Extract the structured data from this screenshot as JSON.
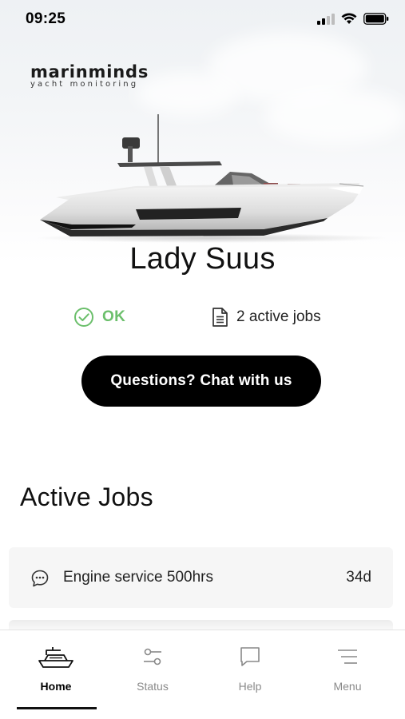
{
  "status_bar": {
    "time": "09:25"
  },
  "brand": {
    "name": "marinminds",
    "tagline": "yacht monitoring"
  },
  "vessel": {
    "name": "Lady Suus"
  },
  "summary": {
    "status": "OK",
    "active_jobs": "2 active jobs",
    "status_color": "#6bbf6b"
  },
  "chat_button": {
    "label": "Questions? Chat with us"
  },
  "active_jobs": {
    "title": "Active Jobs",
    "items": [
      {
        "icon": "chat-bubble-icon",
        "label": "Engine service 500hrs",
        "days": "34d"
      }
    ]
  },
  "tabbar": {
    "tabs": [
      {
        "label": "Home",
        "icon": "yacht-icon",
        "active": true
      },
      {
        "label": "Status",
        "icon": "sliders-icon",
        "active": false
      },
      {
        "label": "Help",
        "icon": "speech-bubble-icon",
        "active": false
      },
      {
        "label": "Menu",
        "icon": "hamburger-icon",
        "active": false
      }
    ]
  }
}
